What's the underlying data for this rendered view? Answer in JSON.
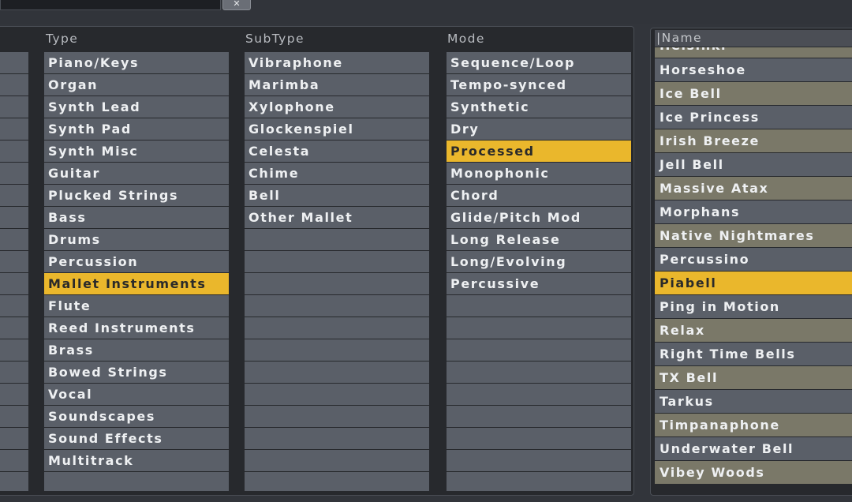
{
  "search": {
    "button_icon": "close-x-icon",
    "button_glyph": "✕"
  },
  "columns": {
    "type": {
      "header": "Type",
      "items": [
        "Piano/Keys",
        "Organ",
        "Synth Lead",
        "Synth Pad",
        "Synth Misc",
        "Guitar",
        "Plucked Strings",
        "Bass",
        "Drums",
        "Percussion",
        "Mallet Instruments",
        "Flute",
        "Reed Instruments",
        "Brass",
        "Bowed Strings",
        "Vocal",
        "Soundscapes",
        "Sound Effects",
        "Multitrack",
        ""
      ],
      "selected": "Mallet Instruments"
    },
    "subtype": {
      "header": "SubType",
      "items": [
        "Vibraphone",
        "Marimba",
        "Xylophone",
        "Glockenspiel",
        "Celesta",
        "Chime",
        "Bell",
        "Other Mallet",
        "",
        "",
        "",
        "",
        "",
        "",
        "",
        "",
        "",
        "",
        "",
        ""
      ],
      "selected": ""
    },
    "mode": {
      "header": "Mode",
      "items": [
        "Sequence/Loop",
        "Tempo-synced",
        "Synthetic",
        "Dry",
        "Processed",
        "Monophonic",
        "Chord",
        "Glide/Pitch Mod",
        "Long Release",
        "Long/Evolving",
        "Percussive",
        "",
        "",
        "",
        "",
        "",
        "",
        "",
        "",
        ""
      ],
      "selected": "Processed"
    }
  },
  "names": {
    "header": "Name",
    "partial_top": "Helsinki",
    "items": [
      "Horseshoe",
      "Ice Bell",
      "Ice Princess",
      "Irish Breeze",
      "Jell Bell",
      "Massive Atax",
      "Morphans",
      "Native Nightmares",
      "Percussino",
      "Piabell",
      "Ping in Motion",
      "Relax",
      "Right Time Bells",
      "TX Bell",
      "Tarkus",
      "Timpanaphone",
      "Underwater Bell",
      "Vibey Woods"
    ],
    "selected": "Piabell"
  },
  "colors": {
    "selection": "#eab72c",
    "row": "#5a5f68",
    "alt_row": "#7a7868",
    "background": "#27292d"
  }
}
